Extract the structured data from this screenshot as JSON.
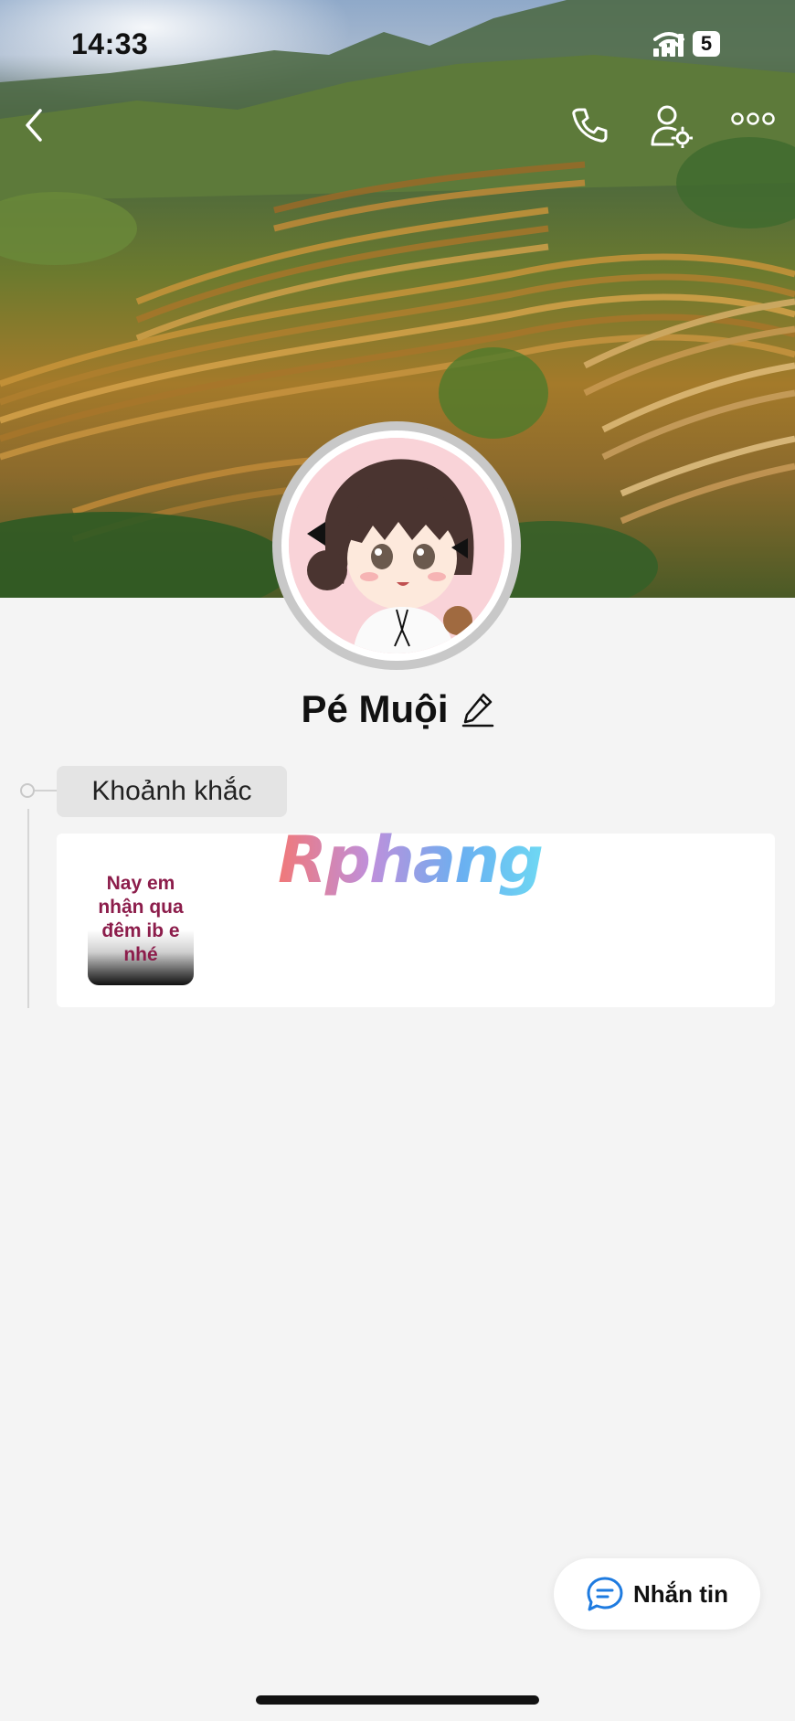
{
  "status_bar": {
    "time": "14:33",
    "battery": "5",
    "icons": [
      "cellular-signal-icon",
      "wifi-icon",
      "battery-icon"
    ]
  },
  "nav": {
    "icons": [
      "back-arrow-icon",
      "phone-icon",
      "user-settings-icon",
      "more-dots-icon"
    ]
  },
  "profile": {
    "name": "Pé Muội",
    "edit_icon": "pencil-icon"
  },
  "moments": {
    "tag_label": "Khoảnh khắc",
    "story_text": "Nay em nhận qua đêm ib e nhé"
  },
  "watermark": "Rphang",
  "message_button": {
    "label": "Nhắn tin",
    "icon": "chat-bubble-icon"
  },
  "colors": {
    "background": "#f4f4f4",
    "accent_blue": "#1e7be0",
    "story_text": "#8c1d4b"
  }
}
